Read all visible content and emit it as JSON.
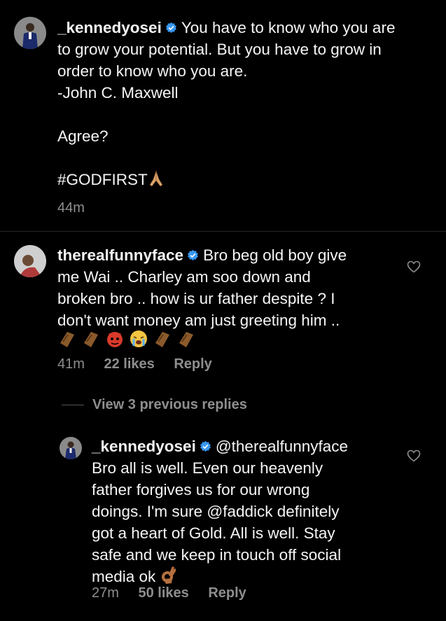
{
  "caption": {
    "username": "_kennedyosei",
    "text": "You have to know who you are\nto grow your potential. But you have to grow in\norder to know who you are.\n-John C. Maxwell\n\nAgree?\n\n#GODFIRST",
    "time": "44m"
  },
  "comments": [
    {
      "username": "therealfunnyface",
      "text": "Bro beg old boy give\nme Wai .. Charley am soo down and\nbroken bro .. how is ur father despite ? I\ndon't want money am just greeting him ..",
      "emojis": [
        "coffin",
        "coffin",
        "devil",
        "crying",
        "coffin",
        "coffin"
      ],
      "time": "41m",
      "likes": "22 likes",
      "reply_label": "Reply"
    }
  ],
  "view_replies": "View 3 previous replies",
  "reply": {
    "username": "_kennedyosei",
    "mention": "@therealfunnyface",
    "text": "Bro all is well. Even our heavenly\nfather forgives us for our wrong\ndoings. I'm sure @faddick definitely\ngot a heart of Gold. All is well. Stay\nsafe and we keep in touch off social\nmedia ok",
    "time": "27m",
    "likes": "50 likes",
    "reply_label": "Reply"
  },
  "colors": {
    "background": "#000000",
    "text": "#f5f5f5",
    "secondary": "#8e8e8e",
    "verified": "#3897f0"
  }
}
